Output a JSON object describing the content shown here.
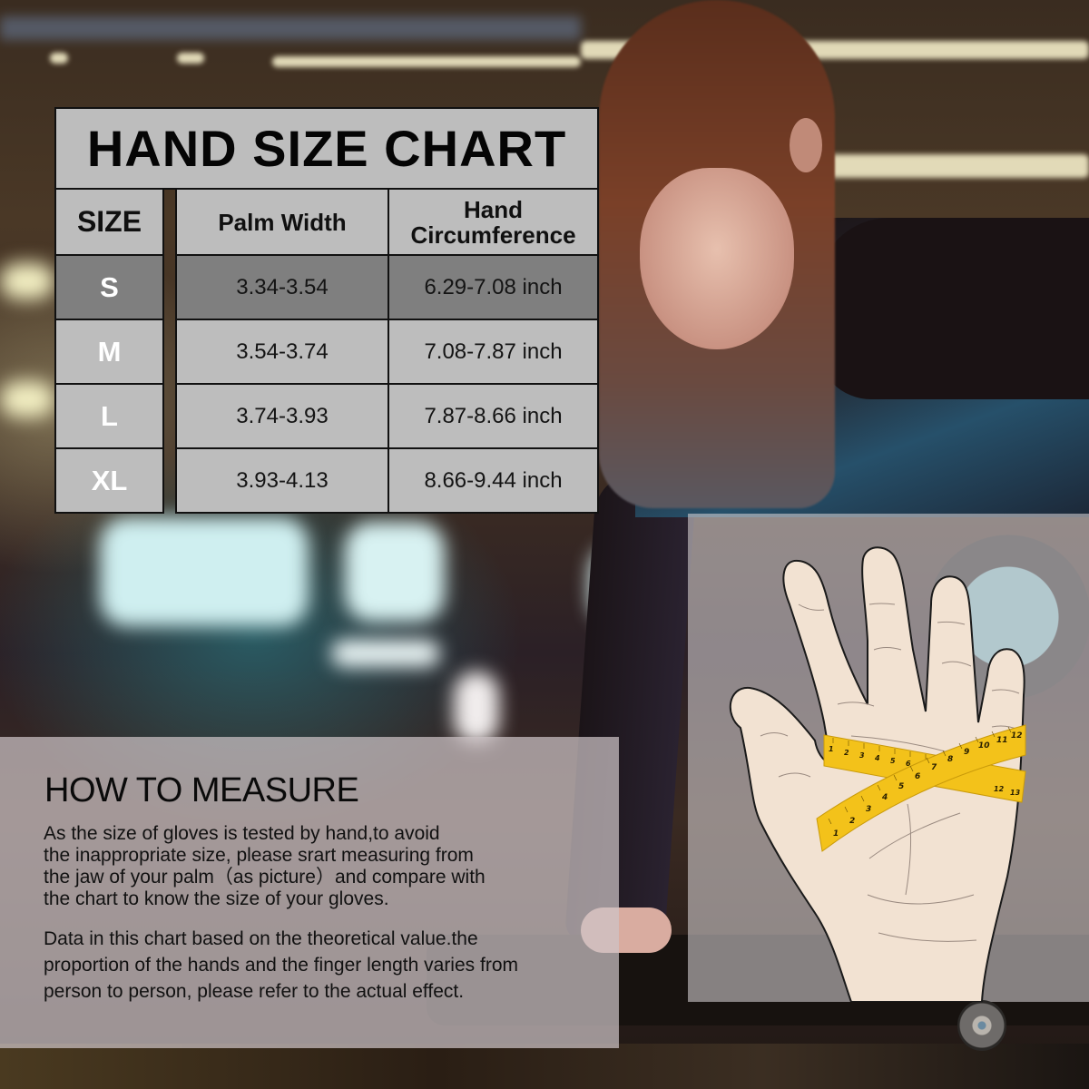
{
  "chart": {
    "title": "HAND SIZE CHART",
    "headers": {
      "size": "SIZE",
      "palm_width": "Palm Width",
      "circumference_line1": "Hand",
      "circumference_line2": "Circumference"
    },
    "rows": [
      {
        "size": "S",
        "palm_width": "3.34-3.54",
        "circumference": "6.29-7.08 inch",
        "highlighted": true
      },
      {
        "size": "M",
        "palm_width": "3.54-3.74",
        "circumference": "7.08-7.87 inch",
        "highlighted": false
      },
      {
        "size": "L",
        "palm_width": "3.74-3.93",
        "circumference": "7.87-8.66 inch",
        "highlighted": false
      },
      {
        "size": "XL",
        "palm_width": "3.93-4.13",
        "circumference": "8.66-9.44 inch",
        "highlighted": false
      }
    ],
    "colors": {
      "cell_bg": "#bdbdbd",
      "highlight_bg": "#7f7f7f",
      "border": "#111111",
      "size_text": "#ffffff"
    }
  },
  "how_to_measure": {
    "title": "HOW TO MEASURE",
    "paragraph1_lines": [
      "As the size of gloves is tested by hand,to avoid",
      "the inappropriate size, please srart measuring from",
      "the jaw of your palm（as picture）and compare with",
      "the chart to know the size of your gloves."
    ],
    "paragraph2_lines": [
      "Data in this chart based on the theoretical value.the",
      "proportion of the hands and the finger length varies from",
      "person to person, please refer to the actual effect."
    ]
  },
  "illustration": {
    "subject": "hand-with-measuring-tapes",
    "tape_a_labels": [
      "1",
      "2",
      "3",
      "4",
      "5",
      "6",
      "7",
      "8",
      "9",
      "10",
      "11",
      "12",
      "13"
    ],
    "tape_b_labels": [
      "1",
      "2",
      "3",
      "4",
      "5",
      "6",
      "7",
      "8",
      "9",
      "10",
      "11",
      "12"
    ],
    "colors": {
      "skin": "#f2e2d2",
      "tape": "#f3c21a",
      "outline": "#1a1a1a"
    }
  }
}
